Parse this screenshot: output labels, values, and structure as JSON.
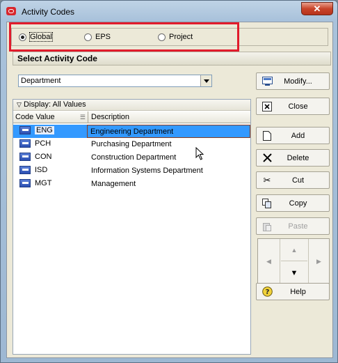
{
  "window": {
    "title": "Activity Codes",
    "close_glyph": "✕"
  },
  "scope": {
    "options": [
      {
        "label": "Global",
        "selected": true
      },
      {
        "label": "EPS",
        "selected": false
      },
      {
        "label": "Project",
        "selected": false
      }
    ]
  },
  "select_section": {
    "header": "Select Activity Code",
    "dropdown_value": "Department"
  },
  "grid": {
    "display_label": "Display: All Values",
    "columns": [
      "Code Value",
      "Description"
    ],
    "rows": [
      {
        "code": "ENG",
        "description": "Engineering Department",
        "selected": true
      },
      {
        "code": "PCH",
        "description": "Purchasing Department",
        "selected": false
      },
      {
        "code": "CON",
        "description": "Construction Department",
        "selected": false
      },
      {
        "code": "ISD",
        "description": "Information Systems Department",
        "selected": false
      },
      {
        "code": "MGT",
        "description": "Management",
        "selected": false
      }
    ]
  },
  "buttons": {
    "modify": "Modify...",
    "close": "Close",
    "add": "Add",
    "delete": "Delete",
    "cut": "Cut",
    "copy": "Copy",
    "paste": "Paste",
    "help": "Help"
  },
  "colors": {
    "selection": "#3399ff",
    "highlight_annotation": "#e11b2c"
  }
}
